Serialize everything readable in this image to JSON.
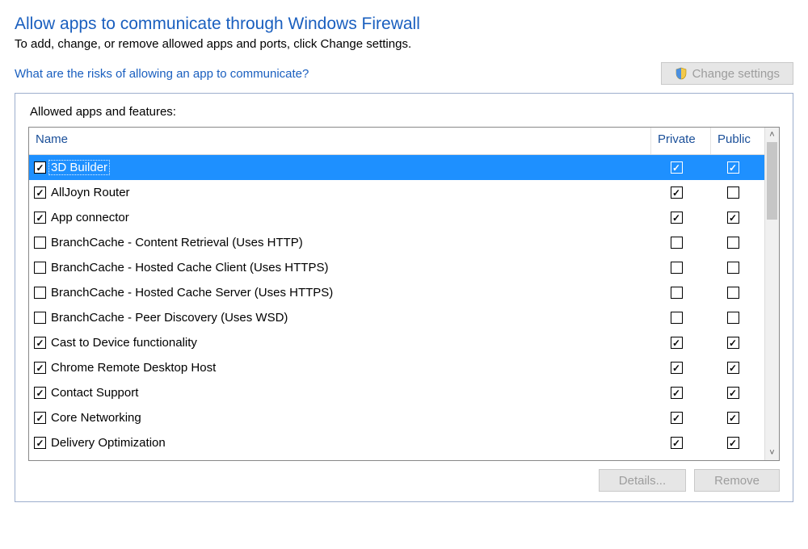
{
  "heading": "Allow apps to communicate through Windows Firewall",
  "subheading": "To add, change, or remove allowed apps and ports, click Change settings.",
  "risks_link": "What are the risks of allowing an app to communicate?",
  "change_settings_label": "Change settings",
  "panel_title": "Allowed apps and features:",
  "columns": {
    "name": "Name",
    "private": "Private",
    "public": "Public"
  },
  "apps": [
    {
      "name": "3D Builder",
      "enabled": true,
      "private": true,
      "public": true,
      "selected": true
    },
    {
      "name": "AllJoyn Router",
      "enabled": true,
      "private": true,
      "public": false,
      "selected": false
    },
    {
      "name": "App connector",
      "enabled": true,
      "private": true,
      "public": true,
      "selected": false
    },
    {
      "name": "BranchCache - Content Retrieval (Uses HTTP)",
      "enabled": false,
      "private": false,
      "public": false,
      "selected": false
    },
    {
      "name": "BranchCache - Hosted Cache Client (Uses HTTPS)",
      "enabled": false,
      "private": false,
      "public": false,
      "selected": false
    },
    {
      "name": "BranchCache - Hosted Cache Server (Uses HTTPS)",
      "enabled": false,
      "private": false,
      "public": false,
      "selected": false
    },
    {
      "name": "BranchCache - Peer Discovery (Uses WSD)",
      "enabled": false,
      "private": false,
      "public": false,
      "selected": false
    },
    {
      "name": "Cast to Device functionality",
      "enabled": true,
      "private": true,
      "public": true,
      "selected": false
    },
    {
      "name": "Chrome Remote Desktop Host",
      "enabled": true,
      "private": true,
      "public": true,
      "selected": false
    },
    {
      "name": "Contact Support",
      "enabled": true,
      "private": true,
      "public": true,
      "selected": false
    },
    {
      "name": "Core Networking",
      "enabled": true,
      "private": true,
      "public": true,
      "selected": false
    },
    {
      "name": "Delivery Optimization",
      "enabled": true,
      "private": true,
      "public": true,
      "selected": false
    }
  ],
  "buttons": {
    "details": "Details...",
    "remove": "Remove"
  },
  "icons": {
    "check": "✓",
    "arrow_up": "˄",
    "arrow_down": "˅"
  }
}
